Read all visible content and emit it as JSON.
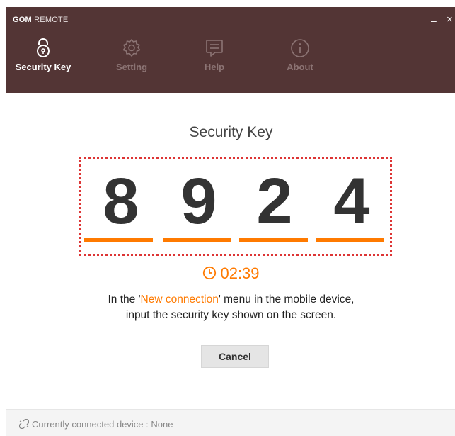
{
  "app": {
    "brand_bold": "GOM",
    "brand_light": "REMOTE",
    "minimize": "–",
    "close": "×"
  },
  "tabs": [
    {
      "label": "Security Key",
      "icon": "lock-icon",
      "active": true
    },
    {
      "label": "Setting",
      "icon": "gear-icon",
      "active": false
    },
    {
      "label": "Help",
      "icon": "chat-icon",
      "active": false
    },
    {
      "label": "About",
      "icon": "info-icon",
      "active": false
    }
  ],
  "main": {
    "title": "Security Key",
    "digits": [
      "8",
      "9",
      "2",
      "4"
    ],
    "timer": "02:39",
    "desc_before": "In the '",
    "desc_accent": "New connection",
    "desc_after": "' menu in the mobile device,",
    "desc_line2": "input the security key shown on the screen.",
    "cancel_label": "Cancel"
  },
  "footer": {
    "status": "Currently connected device : None"
  },
  "colors": {
    "header": "#533535",
    "accent": "#ff7a00",
    "dotted_border": "#dd3535"
  }
}
